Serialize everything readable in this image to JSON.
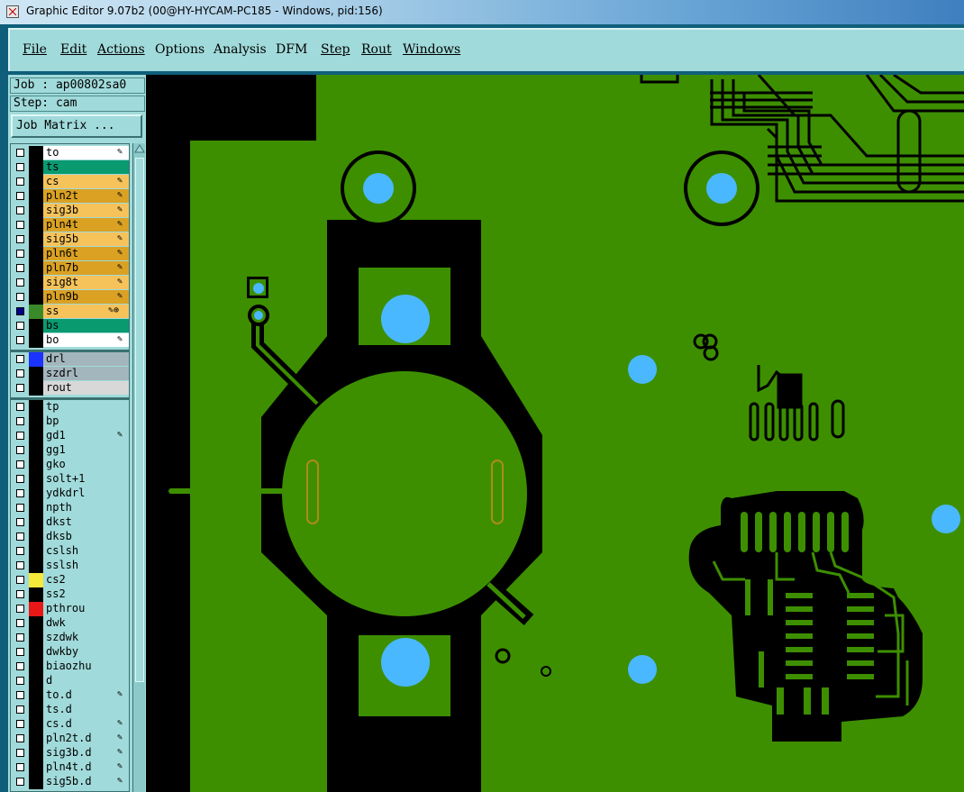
{
  "window": {
    "title": "Graphic Editor 9.07b2 (00@HY-HYCAM-PC185 - Windows, pid:156)"
  },
  "menu": [
    {
      "label": "File",
      "u": true
    },
    {
      "label": "Edit",
      "u": true
    },
    {
      "label": "Actions",
      "u": true
    },
    {
      "label": "Options",
      "u": false
    },
    {
      "label": "Analysis",
      "u": false
    },
    {
      "label": "DFM",
      "u": false
    },
    {
      "label": "Step",
      "u": true
    },
    {
      "label": "Rout",
      "u": true
    },
    {
      "label": "Windows",
      "u": true
    }
  ],
  "info": {
    "job": "Job : ap00802sa0",
    "step": "Step: cam",
    "job_matrix_button": "Job Matrix ..."
  },
  "layers": [
    {
      "name": "to",
      "bg": "#ffffff",
      "swatch": "#000000",
      "checked": false,
      "flag": "✎"
    },
    {
      "name": "ts",
      "bg": "#0a9a70",
      "swatch": "#000000",
      "checked": false,
      "flag": ""
    },
    {
      "name": "cs",
      "bg": "#f6c35a",
      "swatch": "#000000",
      "checked": false,
      "flag": "✎"
    },
    {
      "name": "pln2t",
      "bg": "#daa123",
      "swatch": "#000000",
      "checked": false,
      "flag": "✎"
    },
    {
      "name": "sig3b",
      "bg": "#f6c35a",
      "swatch": "#000000",
      "checked": false,
      "flag": "✎"
    },
    {
      "name": "pln4t",
      "bg": "#daa123",
      "swatch": "#000000",
      "checked": false,
      "flag": "✎"
    },
    {
      "name": "sig5b",
      "bg": "#f6c35a",
      "swatch": "#000000",
      "checked": false,
      "flag": "✎"
    },
    {
      "name": "pln6t",
      "bg": "#daa123",
      "swatch": "#000000",
      "checked": false,
      "flag": "✎"
    },
    {
      "name": "pln7b",
      "bg": "#daa123",
      "swatch": "#000000",
      "checked": false,
      "flag": "✎"
    },
    {
      "name": "sig8t",
      "bg": "#f6c35a",
      "swatch": "#000000",
      "checked": false,
      "flag": "✎"
    },
    {
      "name": "pln9b",
      "bg": "#daa123",
      "swatch": "#000000",
      "checked": false,
      "flag": "✎"
    },
    {
      "name": "ss",
      "bg": "#f6c35a",
      "swatch": "#3a8a2a",
      "checked": true,
      "flag": "✎⊕"
    },
    {
      "name": "bs",
      "bg": "#0a9a70",
      "swatch": "#000000",
      "checked": false,
      "flag": ""
    },
    {
      "name": "bo",
      "bg": "#ffffff",
      "swatch": "#000000",
      "checked": false,
      "flag": "✎"
    },
    {
      "sep": true
    },
    {
      "name": "drl",
      "bg": "#a4b6bd",
      "swatch": "#1a33ff",
      "checked": false,
      "flag": ""
    },
    {
      "name": "szdrl",
      "bg": "#a4b6bd",
      "swatch": "#000000",
      "checked": false,
      "flag": ""
    },
    {
      "name": "rout",
      "bg": "#d8d8d8",
      "swatch": "#000000",
      "checked": false,
      "flag": ""
    },
    {
      "sep": true
    },
    {
      "name": "tp",
      "bg": "#a1dada",
      "swatch": "#000000",
      "checked": false,
      "flag": ""
    },
    {
      "name": "bp",
      "bg": "#a1dada",
      "swatch": "#000000",
      "checked": false,
      "flag": ""
    },
    {
      "name": "gd1",
      "bg": "#a1dada",
      "swatch": "#000000",
      "checked": false,
      "flag": "✎"
    },
    {
      "name": "gg1",
      "bg": "#a1dada",
      "swatch": "#000000",
      "checked": false,
      "flag": ""
    },
    {
      "name": "gko",
      "bg": "#a1dada",
      "swatch": "#000000",
      "checked": false,
      "flag": ""
    },
    {
      "name": "solt+1",
      "bg": "#a1dada",
      "swatch": "#000000",
      "checked": false,
      "flag": ""
    },
    {
      "name": "ydkdrl",
      "bg": "#a1dada",
      "swatch": "#000000",
      "checked": false,
      "flag": ""
    },
    {
      "name": "npth",
      "bg": "#a1dada",
      "swatch": "#000000",
      "checked": false,
      "flag": ""
    },
    {
      "name": "dkst",
      "bg": "#a1dada",
      "swatch": "#000000",
      "checked": false,
      "flag": ""
    },
    {
      "name": "dksb",
      "bg": "#a1dada",
      "swatch": "#000000",
      "checked": false,
      "flag": ""
    },
    {
      "name": "cslsh",
      "bg": "#a1dada",
      "swatch": "#000000",
      "checked": false,
      "flag": ""
    },
    {
      "name": "sslsh",
      "bg": "#a1dada",
      "swatch": "#000000",
      "checked": false,
      "flag": ""
    },
    {
      "name": "cs2",
      "bg": "#a1dada",
      "swatch": "#f5ea3a",
      "checked": false,
      "flag": ""
    },
    {
      "name": "ss2",
      "bg": "#a1dada",
      "swatch": "#000000",
      "checked": false,
      "flag": ""
    },
    {
      "name": "pthrou",
      "bg": "#a1dada",
      "swatch": "#e81818",
      "checked": false,
      "flag": ""
    },
    {
      "name": "dwk",
      "bg": "#a1dada",
      "swatch": "#000000",
      "checked": false,
      "flag": ""
    },
    {
      "name": "szdwk",
      "bg": "#a1dada",
      "swatch": "#000000",
      "checked": false,
      "flag": ""
    },
    {
      "name": "dwkby",
      "bg": "#a1dada",
      "swatch": "#000000",
      "checked": false,
      "flag": ""
    },
    {
      "name": "biaozhu",
      "bg": "#a1dada",
      "swatch": "#000000",
      "checked": false,
      "flag": ""
    },
    {
      "name": "d",
      "bg": "#a1dada",
      "swatch": "#000000",
      "checked": false,
      "flag": ""
    },
    {
      "name": "to.d",
      "bg": "#a1dada",
      "swatch": "#000000",
      "checked": false,
      "flag": "✎"
    },
    {
      "name": "ts.d",
      "bg": "#a1dada",
      "swatch": "#000000",
      "checked": false,
      "flag": ""
    },
    {
      "name": "cs.d",
      "bg": "#a1dada",
      "swatch": "#000000",
      "checked": false,
      "flag": "✎"
    },
    {
      "name": "pln2t.d",
      "bg": "#a1dada",
      "swatch": "#000000",
      "checked": false,
      "flag": "✎"
    },
    {
      "name": "sig3b.d",
      "bg": "#a1dada",
      "swatch": "#000000",
      "checked": false,
      "flag": "✎"
    },
    {
      "name": "pln4t.d",
      "bg": "#a1dada",
      "swatch": "#000000",
      "checked": false,
      "flag": "✎"
    },
    {
      "name": "sig5b.d",
      "bg": "#a1dada",
      "swatch": "#000000",
      "checked": false,
      "flag": "✎"
    }
  ],
  "colors": {
    "board": "#3d8f00",
    "clearance": "#000000",
    "drill": "#4ab8ff",
    "slot": "#b08a18",
    "panel": "#a1dada"
  }
}
